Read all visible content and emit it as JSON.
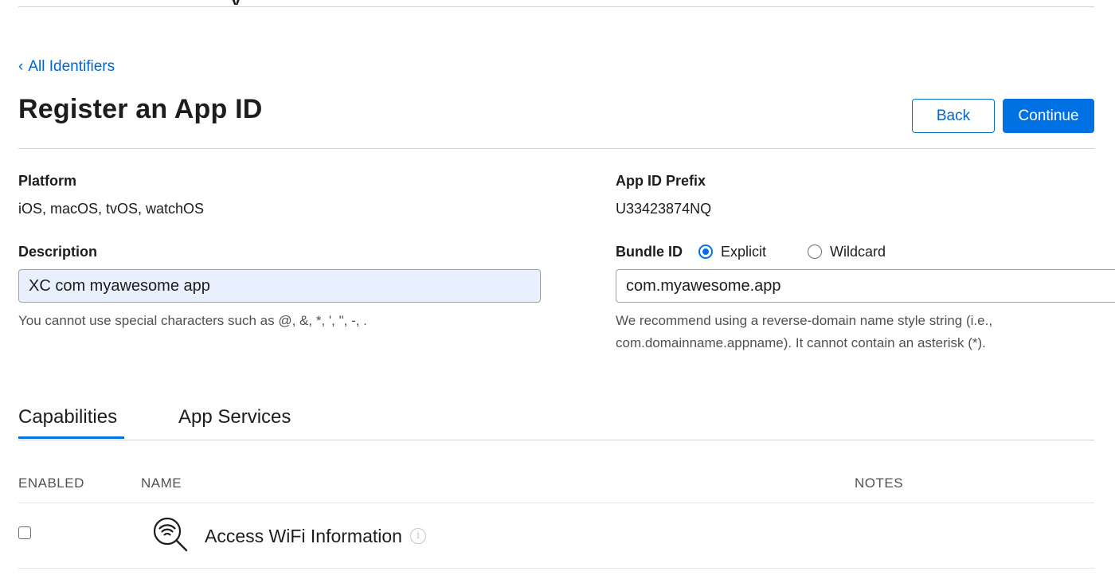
{
  "header": {
    "partial_title": "y",
    "breadcrumb_chevron": "‹",
    "breadcrumb_label": "All Identifiers",
    "title": "Register an App ID",
    "back_label": "Back",
    "continue_label": "Continue"
  },
  "platform": {
    "label": "Platform",
    "value": "iOS, macOS, tvOS, watchOS"
  },
  "app_id_prefix": {
    "label": "App ID Prefix",
    "value": "U33423874NQ"
  },
  "description": {
    "label": "Description",
    "value": "XC com myawesome app",
    "hint": "You cannot use special characters such as @, &, *, ', \", -, ."
  },
  "bundle_id": {
    "label": "Bundle ID",
    "options": [
      {
        "label": "Explicit",
        "selected": true
      },
      {
        "label": "Wildcard",
        "selected": false
      }
    ],
    "value": "com.myawesome.app",
    "hint_line1": "We recommend using a reverse-domain name style string (i.e.,",
    "hint_line2": "com.domainname.appname). It cannot contain an asterisk (*)."
  },
  "tabs": [
    {
      "label": "Capabilities",
      "active": true
    },
    {
      "label": "App Services",
      "active": false
    }
  ],
  "table": {
    "columns": [
      "ENABLED",
      "NAME",
      "NOTES"
    ],
    "rows": [
      {
        "enabled": false,
        "icon": "wifi-search-icon",
        "name": "Access WiFi Information",
        "notes": ""
      }
    ]
  },
  "colors": {
    "accent": "#0071e3",
    "link": "#0066cc",
    "autofill_bg": "#e8f0fe"
  }
}
